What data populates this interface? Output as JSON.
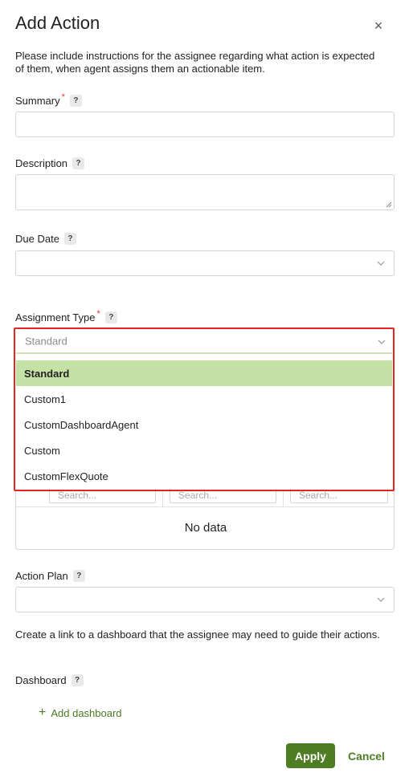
{
  "dialog": {
    "title": "Add Action",
    "close_glyph": "×",
    "intro": "Please include instructions for the assignee regarding what action is expected of them, when agent assigns them an actionable item."
  },
  "fields": {
    "summary": {
      "label": "Summary",
      "required": "*",
      "help": "?",
      "value": ""
    },
    "description": {
      "label": "Description",
      "help": "?",
      "value": ""
    },
    "due_date": {
      "label": "Due Date",
      "help": "?",
      "value": ""
    },
    "assignment_type": {
      "label": "Assignment Type",
      "required": "*",
      "help": "?",
      "placeholder": "Standard"
    },
    "action_plan": {
      "label": "Action Plan",
      "help": "?",
      "value": ""
    },
    "dashboard": {
      "label": "Dashboard",
      "help": "?"
    }
  },
  "assignment_options": [
    "Standard",
    "Custom1",
    "CustomDashboardAgent",
    "Custom",
    "CustomFlexQuote"
  ],
  "table": {
    "search_placeholders": [
      "Search...",
      "Search...",
      "Search..."
    ],
    "empty_text": "No data"
  },
  "dashboard_text": "Create a link to a dashboard that the assignee may need to guide their actions.",
  "add_dashboard_label": "Add dashboard",
  "buttons": {
    "apply": "Apply",
    "cancel": "Cancel"
  },
  "colors": {
    "accent": "#4e7d24",
    "selected_option": "#c5e1a5",
    "focus_outline": "#e2261f"
  }
}
